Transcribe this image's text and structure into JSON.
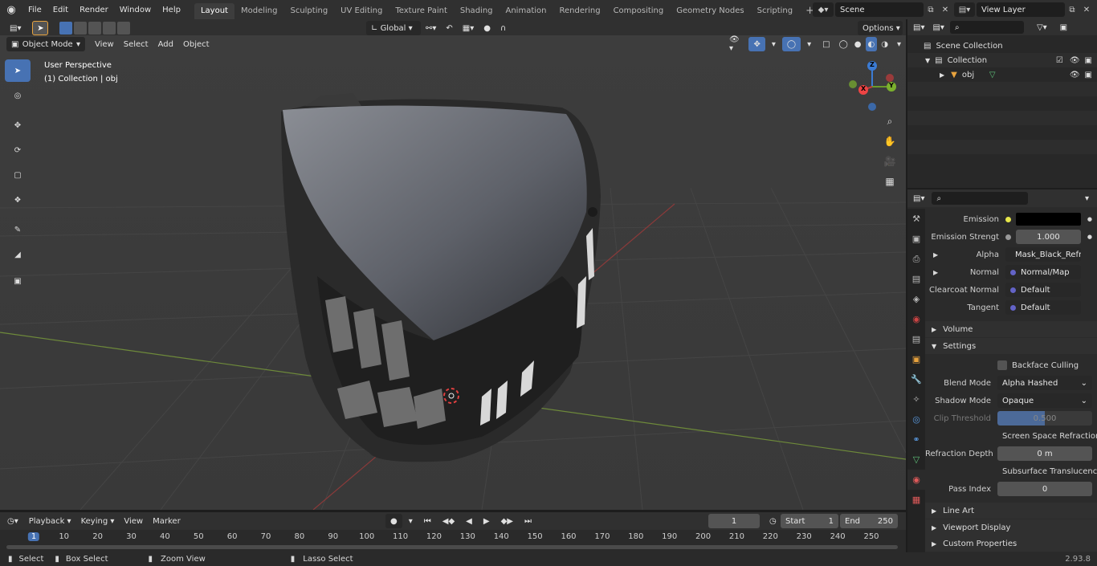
{
  "menu": [
    "File",
    "Edit",
    "Render",
    "Window",
    "Help"
  ],
  "workspaces": [
    "Layout",
    "Modeling",
    "Sculpting",
    "UV Editing",
    "Texture Paint",
    "Shading",
    "Animation",
    "Rendering",
    "Compositing",
    "Geometry Nodes",
    "Scripting"
  ],
  "scene": "Scene",
  "view_layer": "View Layer",
  "header": {
    "mode": "Object Mode",
    "menus": [
      "View",
      "Select",
      "Add",
      "Object"
    ],
    "orientation": "Global",
    "options": "Options"
  },
  "viewport": {
    "perspective": "User Perspective",
    "collection": "(1) Collection | obj",
    "gizmo": {
      "x": "X",
      "y": "Y",
      "z": "Z"
    }
  },
  "outliner": {
    "scene_collection": "Scene Collection",
    "collection": "Collection",
    "object": "obj"
  },
  "properties": {
    "emission": "Emission",
    "emission_strength_label": "Emission Strengt",
    "emission_strength": "1.000",
    "alpha": "Alpha",
    "alpha_val": "Mask_Black_Refract...",
    "normal": "Normal",
    "normal_val": "Normal/Map",
    "clearcoat": "Clearcoat Normal",
    "clearcoat_val": "Default",
    "tangent": "Tangent",
    "tangent_val": "Default",
    "volume": "Volume",
    "settings": "Settings",
    "backface": "Backface Culling",
    "blend_label": "Blend Mode",
    "blend_val": "Alpha Hashed",
    "shadow_label": "Shadow Mode",
    "shadow_val": "Opaque",
    "clip_label": "Clip Threshold",
    "clip_val": "0.500",
    "clip_fraction": 0.5,
    "ssr": "Screen Space Refraction",
    "refr_label": "Refraction Depth",
    "refr_val": "0 m",
    "sss": "Subsurface Translucency",
    "pass_label": "Pass Index",
    "pass_val": "0",
    "line_art": "Line Art",
    "viewport_display": "Viewport Display",
    "custom_props": "Custom Properties"
  },
  "timeline": {
    "menus": [
      "Playback",
      "Keying",
      "View",
      "Marker"
    ],
    "frame": "1",
    "start_label": "Start",
    "start": "1",
    "end_label": "End",
    "end": "250",
    "ticks": [
      "1",
      "10",
      "20",
      "30",
      "40",
      "50",
      "60",
      "70",
      "80",
      "90",
      "100",
      "110",
      "120",
      "130",
      "140",
      "150",
      "160",
      "170",
      "180",
      "190",
      "200",
      "210",
      "220",
      "230",
      "240",
      "250"
    ]
  },
  "status": {
    "select": "Select",
    "box": "Box Select",
    "zoom": "Zoom View",
    "lasso": "Lasso Select",
    "version": "2.93.8"
  }
}
